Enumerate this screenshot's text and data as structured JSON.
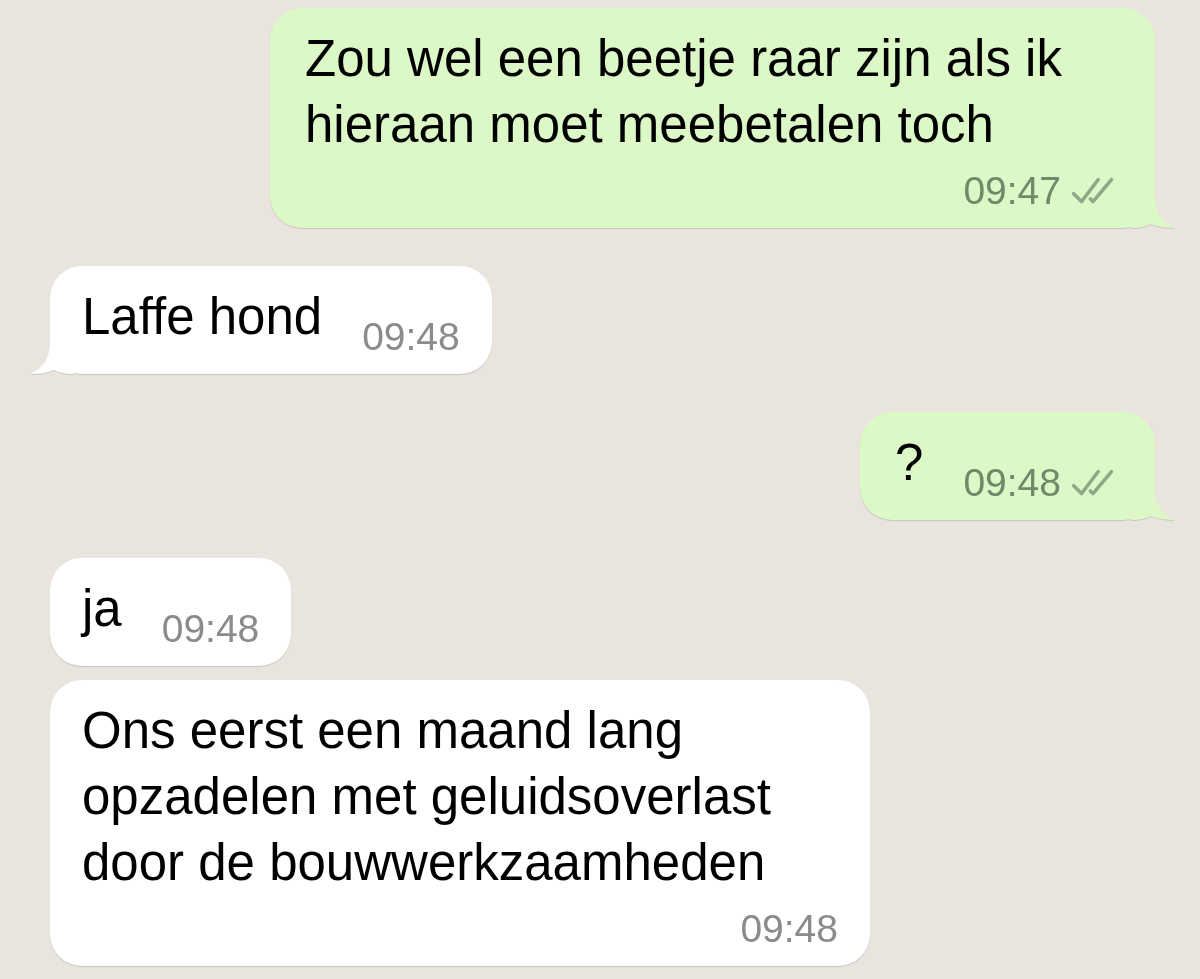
{
  "messages": [
    {
      "kind": "outgoing",
      "text": "Zou wel een beetje raar zijn als ik hieraan moet meebetalen toch",
      "time": "09:47",
      "read": false,
      "tail": true
    },
    {
      "kind": "incoming",
      "text": "Laffe hond",
      "time": "09:48",
      "tail": true
    },
    {
      "kind": "outgoing",
      "text": "?",
      "time": "09:48",
      "read": false,
      "tail": true
    },
    {
      "kind": "incoming",
      "text": "ja",
      "time": "09:48",
      "tail": false
    },
    {
      "kind": "incoming",
      "text": "Ons eerst een maand lang opzadelen met geluidsoverlast door de bouwwerkzaamheden",
      "time": "09:48",
      "tail": false
    }
  ]
}
